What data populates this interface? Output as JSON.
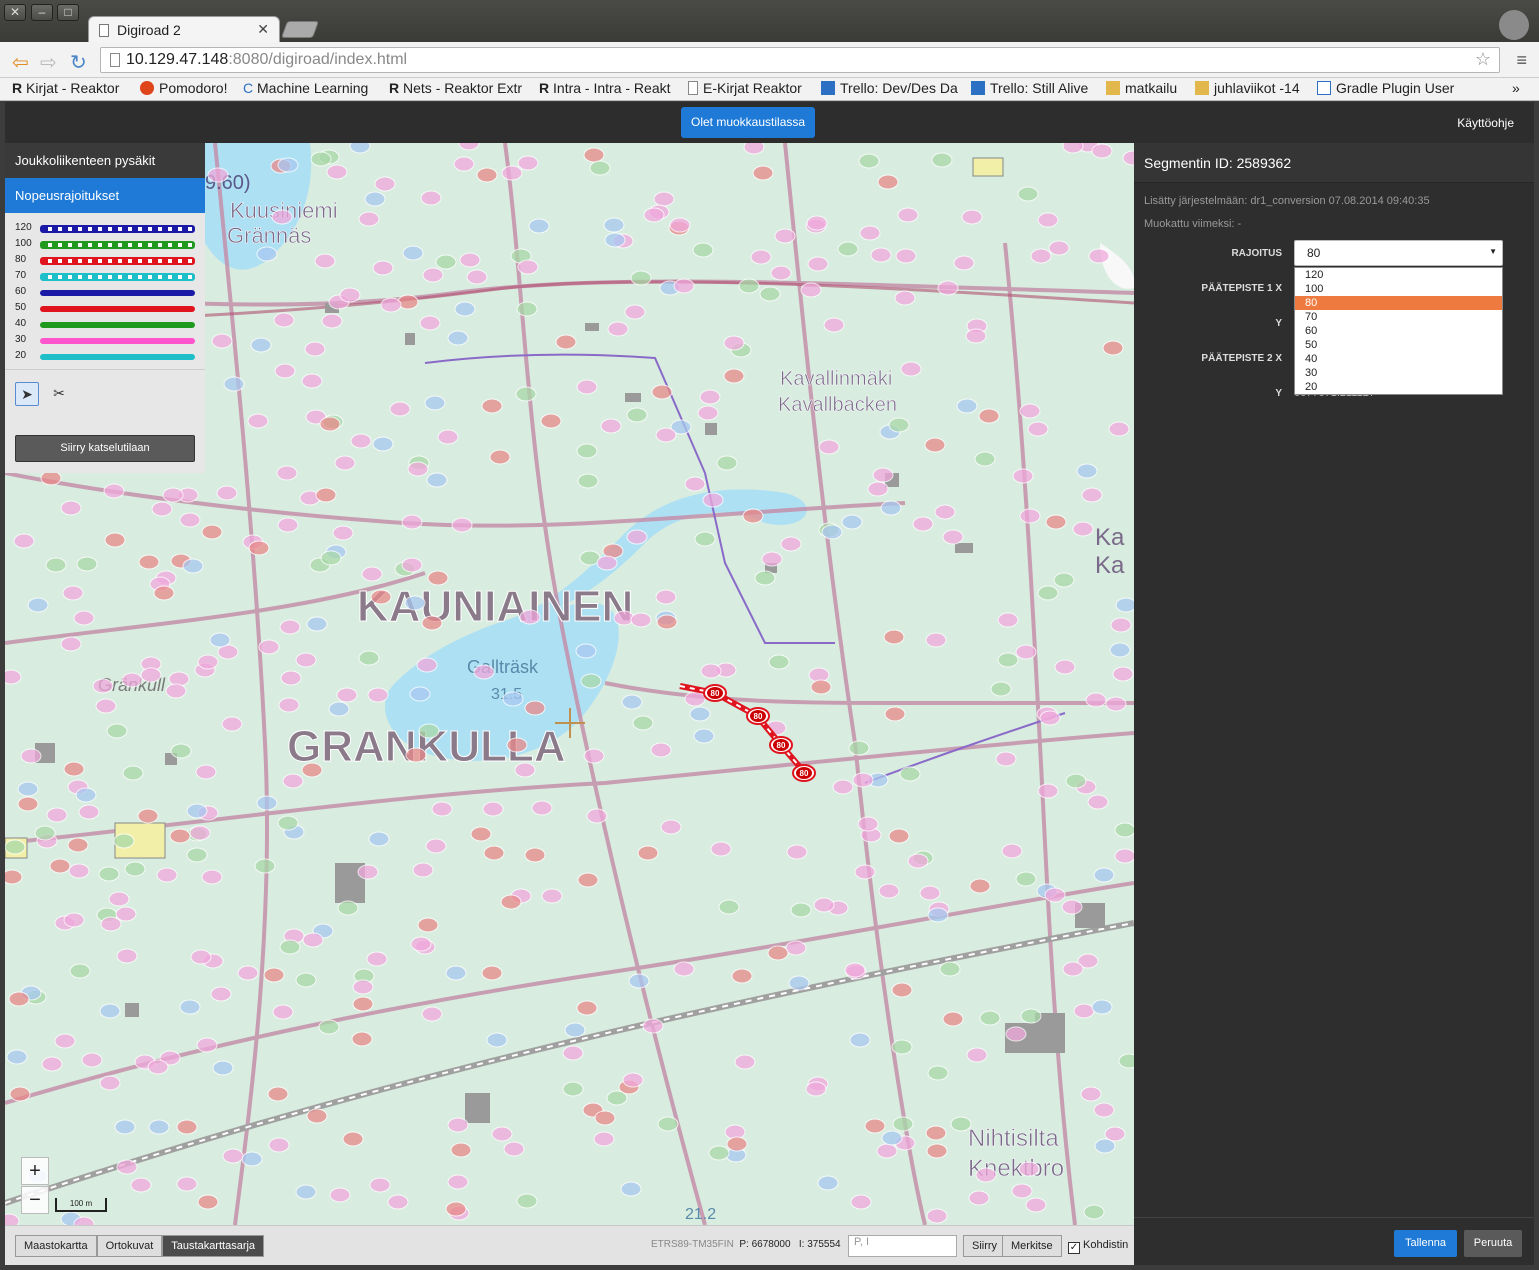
{
  "browser": {
    "tab_title": "Digiroad 2",
    "url_host": "10.129.47.148",
    "url_rest": ":8080/digiroad/index.html",
    "bookmarks": [
      "Kirjat - Reaktor",
      "Pomodoro!",
      "Machine Learning",
      "Nets - Reaktor Extr",
      "Intra - Intra - Reakt",
      "E-Kirjat Reaktor",
      "Trello: Dev/Des Da",
      "Trello: Still Alive",
      "matkailu",
      "juhlaviikot -14",
      "Gradle Plugin User"
    ]
  },
  "header": {
    "edit_mode_label": "Olet muokkaustilassa",
    "help_label": "Käyttöohje"
  },
  "left_panel": {
    "items": [
      {
        "label": "Joukkoliikenteen pysäkit"
      },
      {
        "label": "Nopeusrajoitukset"
      }
    ],
    "legend": [
      {
        "label": "120",
        "color": "#1a1aa6",
        "dashed": true
      },
      {
        "label": "100",
        "color": "#1f9a1f",
        "dashed": true
      },
      {
        "label": "80",
        "color": "#e0141e",
        "dashed": true
      },
      {
        "label": "70",
        "color": "#1fbfc9",
        "dashed": true
      },
      {
        "label": "60",
        "color": "#1a1aa6",
        "dashed": false
      },
      {
        "label": "50",
        "color": "#e0141e",
        "dashed": false
      },
      {
        "label": "40",
        "color": "#1f9a1f",
        "dashed": false
      },
      {
        "label": "30",
        "color": "#ff55cc",
        "dashed": false
      },
      {
        "label": "20",
        "color": "#1fbfc9",
        "dashed": false
      }
    ],
    "tools": [
      "select-arrow-icon",
      "scissors-icon"
    ],
    "view_mode_button": "Siirry katselutilaan"
  },
  "map": {
    "labels": {
      "kuusiniemi": "Kuusiniemi",
      "grannas": "Grännäs",
      "kauniainen": "KAUNIAINEN",
      "grankulla": "GRANKULLA",
      "grankull": "Gränkull",
      "gallträsk": "Gallträsk",
      "lake_level": "31.5",
      "kavallinmaki": "Kavallinmäki",
      "kavallbacken": "Kavallbacken",
      "nihtisilta": "Nihtisilta",
      "knektbro": "Knektbro",
      "partial_960": "9.60)",
      "partial_ka1": "Ka",
      "partial_ka2": "Ka",
      "elev_212": "21.2"
    },
    "selected_segment_value": "80",
    "zoom_in": "+",
    "zoom_out": "−",
    "scale": "100 m"
  },
  "bottom_bar": {
    "basemaps": [
      {
        "label": "Maastokartta",
        "selected": false
      },
      {
        "label": "Ortokuvat",
        "selected": false
      },
      {
        "label": "Taustakarttasarja",
        "selected": true
      }
    ],
    "projection": "ETRS89-TM35FIN",
    "p_coord": "P: 6678000",
    "i_coord": "I: 375554",
    "coord_placeholder": "P, I",
    "move_button": "Siirry",
    "mark_button": "Merkitse",
    "crosshair_label": "Kohdistin",
    "crosshair_checked": "✓"
  },
  "right_panel": {
    "title": "Segmentin ID: 2589362",
    "added": "Lisätty järjestelmään: dr1_conversion 07.08.2014 09:40:35",
    "modified": "Muokattu viimeksi: -",
    "limit_label": "RAJOITUS",
    "limit_value": "80",
    "endpoint1_label": "PÄÄTEPISTE 1 X",
    "y1_label": "Y",
    "endpoint2_label": "PÄÄTEPISTE 2 X",
    "y2_label": "Y",
    "y2_value_partial": "6677671.211127",
    "options": [
      "120",
      "100",
      "80",
      "70",
      "60",
      "50",
      "40",
      "30",
      "20"
    ],
    "save_button": "Tallenna",
    "cancel_button": "Peruuta"
  }
}
